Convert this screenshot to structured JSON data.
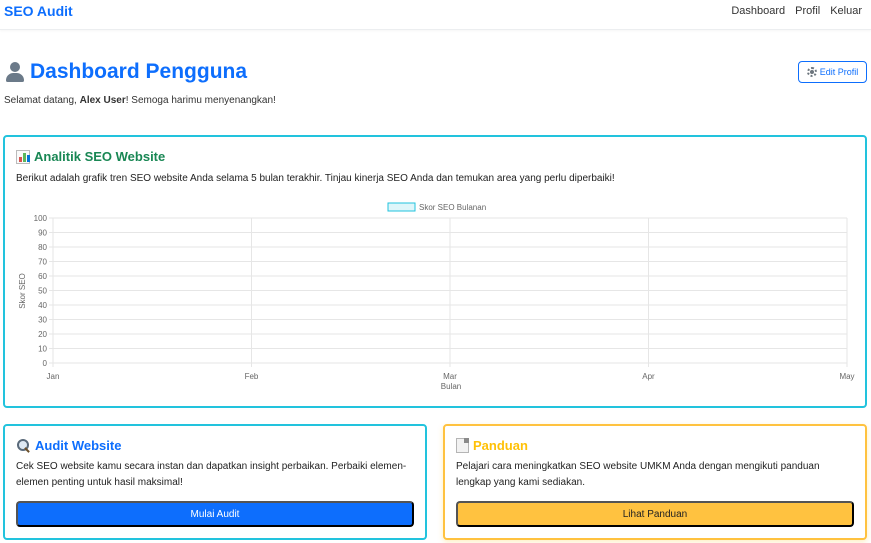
{
  "nav": {
    "brand": "SEO Audit",
    "links": [
      "Dashboard",
      "Profil",
      "Keluar"
    ]
  },
  "header": {
    "title": "Dashboard Pengguna",
    "edit_button": "Edit Profil",
    "welcome_prefix": "Selamat datang, ",
    "user_name": "Alex User",
    "welcome_suffix": "! Semoga harimu menyenangkan!"
  },
  "analytics": {
    "title": "Analitik SEO Website",
    "description": "Berikut adalah grafik tren SEO website Anda selama 5 bulan terakhir. Tinjau kinerja SEO Anda dan temukan area yang perlu diperbaiki!"
  },
  "chart_data": {
    "type": "line",
    "categories": [
      "Jan",
      "Feb",
      "Mar",
      "Apr",
      "May"
    ],
    "series": [
      {
        "name": "Skor SEO Bulanan",
        "values": [],
        "color": "#22c3dd"
      }
    ],
    "xlabel": "Bulan",
    "ylabel": "Skor SEO",
    "ylim": [
      0,
      100
    ],
    "yticks": [
      0,
      10,
      20,
      30,
      40,
      50,
      60,
      70,
      80,
      90,
      100
    ],
    "grid": true,
    "legend": "top"
  },
  "audit": {
    "title": "Audit Website",
    "description": "Cek SEO website kamu secara instan dan dapatkan insight perbaikan. Perbaiki elemen-elemen penting untuk hasil maksimal!",
    "button": "Mulai Audit"
  },
  "guide": {
    "title": "Panduan",
    "description": "Pelajari cara meningkatkan SEO website UMKM Anda dengan mengikuti panduan lengkap yang kami sediakan.",
    "button": "Lihat Panduan"
  },
  "colors": {
    "primary": "#0d6efd",
    "info": "#22c3dd",
    "warning": "#ffc240",
    "success": "#198754"
  }
}
